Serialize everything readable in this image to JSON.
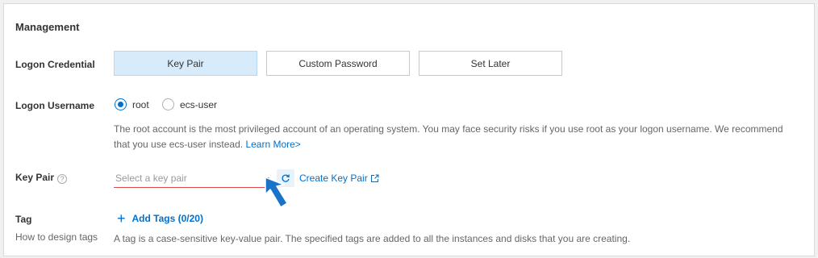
{
  "section": {
    "title": "Management"
  },
  "logon_credential": {
    "label": "Logon Credential",
    "options": [
      "Key Pair",
      "Custom Password",
      "Set Later"
    ],
    "selected": "Key Pair"
  },
  "logon_username": {
    "label": "Logon Username",
    "options": [
      "root",
      "ecs-user"
    ],
    "selected": "root",
    "help_text": "The root account is the most privileged account of an operating system. You may face security risks if you use root as your logon username. We recommend that you use ecs-user instead.",
    "learn_more": "Learn More>"
  },
  "key_pair": {
    "label": "Key Pair",
    "help_icon": "?",
    "placeholder": "Select a key pair",
    "create_link": "Create Key Pair"
  },
  "tag": {
    "label": "Tag",
    "sub_label": "How to design tags",
    "add_button": "Add Tags (0/20)",
    "help_text": "A tag is a case-sensitive key-value pair. The specified tags are added to all the instances and disks that you are creating."
  },
  "colors": {
    "accent": "#0070cc",
    "active_bg": "#d8ebfa",
    "error_underline": "#e0474c",
    "pointer": "#1a73c8"
  }
}
